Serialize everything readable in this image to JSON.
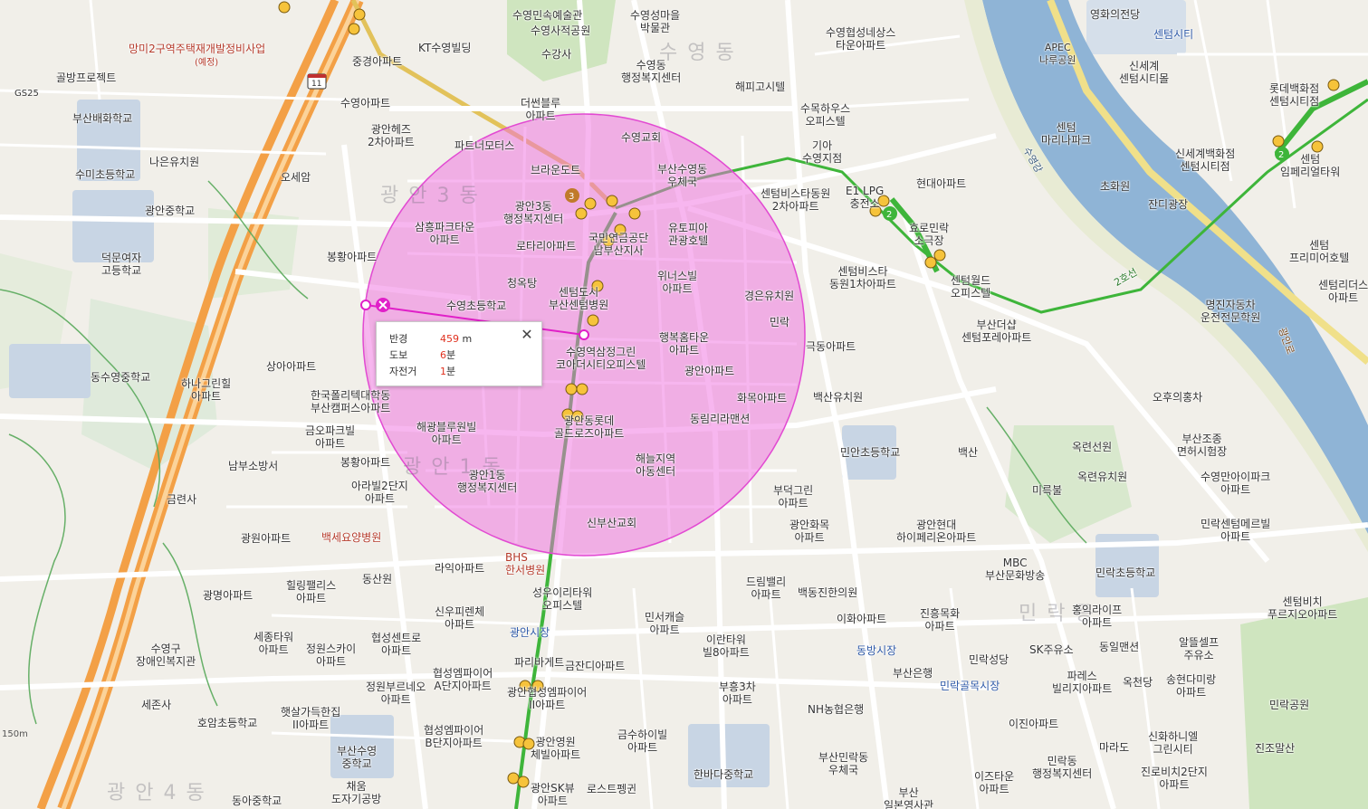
{
  "districts": {
    "suyeong_dong": "수 영 동",
    "gwangan3": "광 안 3 동",
    "gwangan1": "광 안 1 동",
    "gwangan4": "광 안 4 동",
    "millak": "민 락 동"
  },
  "labels": {
    "mangmi_redev": "망미2구역주택재개발정비사업",
    "mangmi_redev_sub": "(예정)",
    "golbang": "골방프로젝트",
    "gs25": "GS25",
    "busan_baehwa": "부산배화학교",
    "sumi_elem": "수미초등학교",
    "naeun": "나은유치원",
    "gwangan_mid": "광안중학교",
    "deokmun": "덕문여자\n고등학교",
    "dongsu_mid": "동수영중학교",
    "haneul_green": "하나그린힐\n아파트",
    "namu_sobangseo": "남부소방서",
    "geumryeonsa": "금련사",
    "suyeonggu_welfare": "수영구\n장애인복지관",
    "sejonsa": "세존사",
    "hoam_elem": "호암초등학교",
    "haetsal": "햇살가득한집\nII아파트",
    "busan_suyeong_mid": "부산수영\n중학교",
    "chaeum": "채움\n도자기공방",
    "dongah_mid": "동아중학교",
    "kt_suyeong": "KT수영빌딩",
    "jungyeong_apt": "중경아파트",
    "suyeong_apt": "수영아파트",
    "gwangan_heights": "광안헤즈\n2차아파트",
    "osesam": "오세암",
    "samheung": "삼흥파크타운\n아파트",
    "bonghwang": "봉황아파트",
    "suyeong_elem": "수영초등학교",
    "sangah": "상아아파트",
    "polytech": "한국폴리텍대학동\n부산캠퍼스아파트",
    "geumo_park": "금오파크빌\n아파트",
    "bonghwang2": "봉황아파트",
    "arirang": "아라빌2단지\n아파트",
    "gwangwon": "광원아파트",
    "baekse": "백세요양병원",
    "hilling_palace": "힐링팰리스\n아파트",
    "gwangmyeong": "광명아파트",
    "sejong_tower": "세종타워\n아파트",
    "jungwon_sky": "정원스카이\n아파트",
    "jungwon_bune": "정원부르네오\n아파트",
    "dongsanwon": "동산원",
    "hyeopseong_centro": "협성센트로\n아파트",
    "raon": "라익아파트",
    "sinwoo": "신우피렌체\n아파트",
    "gwangan_market": "광안시장",
    "paris": "파리바게트",
    "hyeopseong_empire": "협성엠파이어\nA단지아파트",
    "hyeopseong_empire_b": "협성엠파이어\nB단지아파트",
    "gwangan_empire": "광안협성엠파이어\nII아파트",
    "gwangan_sk": "광안SK뷰\n아파트",
    "gwangan_yeongwon": "광안영원\n체빌아파트",
    "suyeong_folk": "수영민속예술관",
    "suyeong_sajeok": "수영사적공원",
    "sugangsa": "수강사",
    "suyeong_admin": "수영동\n행정복지센터",
    "deosen": "더썬블루\n아파트",
    "partner": "파트너모터스",
    "brown": "브라운도트",
    "gwangan3_admin": "광안3동\n행정복지센터",
    "suyeong_church": "수영교회",
    "rotary": "로타리아파트",
    "cheongoktang": "청옥탕",
    "centum_hospital": "센텀도시\n부산센텀병원",
    "busan_post": "부산수영동\n우체국",
    "utopia": "유토피아\n관광호텔",
    "corporation": "국민연금공단\n남부산지사",
    "haepi": "해피고시텔",
    "suyeong_village": "수영성마을\n박물관",
    "winners": "위너스빌\n아파트",
    "suyeong_stn_green": "수영역삼정그린\n코아더시티오피스텔",
    "haengbok": "행복홈타운\n아파트",
    "gwangan_apt": "광안아파트",
    "hwamok": "화목아파트",
    "dongrim": "동림리라맨션",
    "haegwang": "해광블루원빌\n아파트",
    "gwangan1_admin": "광안1동\n행정복지센터",
    "haeneul": "해늘지역\n아동센터",
    "lotte_golden": "광안동롯데\n골드로즈아파트",
    "sinbusan_church": "신부산교회",
    "bhs_hospital": "BHS\n한서병원",
    "sungwoo": "성우이리타워\n오피스텔",
    "mingseo": "민서캐슬\n아파트",
    "geumjandi": "금잔디아파트",
    "geumsu": "금수하이빌\n아파트",
    "roast": "로스트펭귄",
    "centum_bista2": "센텀비스타동원\n2차아파트",
    "kyungeun": "경은유치원",
    "mirak": "민락",
    "geukdong": "극동아파트",
    "baeksan_kinder": "백산유치원",
    "minan_elem": "민안초등학교",
    "budeok": "부덕그린\n아파트",
    "gwangan_hwadong": "광안화목\n아파트",
    "dream_valley": "드림밸리\n아파트",
    "baekdong": "백동진한의원",
    "iwha": "이화아파트",
    "eritower": "이란타워\n빌8아파트",
    "bueung3": "부흥3차\n아파트",
    "nh_bank": "NH농협은행",
    "busan_millak_post": "부산민락동\n우체국",
    "hanbit_elem": "한바다중학교",
    "gwangan_hyundai": "광안현대\n하이페리온아파트",
    "dongbang_market": "동방시장",
    "busan_bank": "부산은행",
    "millak_alley": "민락골목시장",
    "jinyeong": "진흥목화\n아파트",
    "minrak_church": "민락성당",
    "sk_oil": "SK주유소",
    "dongil": "동일맨션",
    "paris2": "파레스\n빌리지아파트",
    "okcheondang": "옥천당",
    "songhyeon": "송현다미랑\n아파트",
    "ijin": "이진아파트",
    "millak_admin": "민락동\n행정복지센터",
    "marado": "마라도",
    "shinhwa": "신화하니엘\n그린시티",
    "jinro": "진로비치2단지\n아파트",
    "izutaun": "이즈타운\n아파트",
    "busan_ilbon": "부산\n일본영사관",
    "suyeong_hyeopseong": "수영협성네상스\n타운아파트",
    "sumok": "수목하우스\n오피스텔",
    "giya": "기아\n수영지점",
    "e1_lpg": "E1 LPG\n충전소",
    "hyundai_apt": "현대아파트",
    "hyoro": "효로민락\n소극장",
    "centum_world": "센텀월드\n오피스텔",
    "centum_vista1": "센텀비스타\n동원1차아파트",
    "busan_dae": "부산더샵\n센텀포레아파트",
    "ohu": "오후의홍차",
    "baeksan": "백산",
    "okryeon": "옥련선원",
    "okryeon_kinder": "옥련유치원",
    "mirukbul": "미륵불",
    "busan_jogye": "부산조종\n면허시험장",
    "suyeong_bay": "수영만아이파크\n아파트",
    "mbc": "MBC\n부산문화방송",
    "minrak_elem": "민락초등학교",
    "millak_centum": "민락센텀메르빌\n아파트",
    "hongik": "홍익라이프\n아파트",
    "centum_beach": "센텀비치\n푸르지오아파트",
    "alttel": "알뜰셀프\n주유소",
    "millak_park": "민락공원",
    "jinjo": "진조말산",
    "yeonghwa": "영화의전당",
    "centum_city": "센텀시티",
    "apec": "APEC\n나루공원",
    "shinsegae_city": "신세계\n센텀시티몰",
    "lotte_dept": "롯데백화점\n센텀시티점",
    "centum_marina": "센텀\n마리나파크",
    "chowon": "초화원",
    "shinsegae_dept": "신세계백화점\n센텀시티점",
    "centum_imperial": "센텀\n임페리얼타워",
    "jandi": "잔디광장",
    "centum_premier": "센텀\n프리미어호텔",
    "centum_lidus": "센텀리더스\n아파트",
    "myeongjin": "명진자동차\n운전전문학원",
    "road_sign_11": "11",
    "line2_label": "2호선",
    "line3_label": "3호선",
    "suyeong_river": "수영강",
    "gwangan_ro": "광안로"
  },
  "measurement": {
    "radius_label": "반경",
    "radius_value": "459",
    "radius_unit": " m",
    "walk_label": "도보",
    "walk_value": "6",
    "walk_unit": "분",
    "bike_label": "자전거",
    "bike_value": "1",
    "bike_unit": "분",
    "close_glyph": "✕"
  },
  "scale_label": "150m",
  "colors": {
    "circle_fill": "#f06ee0",
    "circle_stroke": "#e24ad2",
    "line2": "#3eb53a",
    "line3": "#c07a2a",
    "highway": "#f3a046",
    "river": "#8fb4d6",
    "park": "#c7dfb6",
    "accent_distance": "#e0301e"
  }
}
